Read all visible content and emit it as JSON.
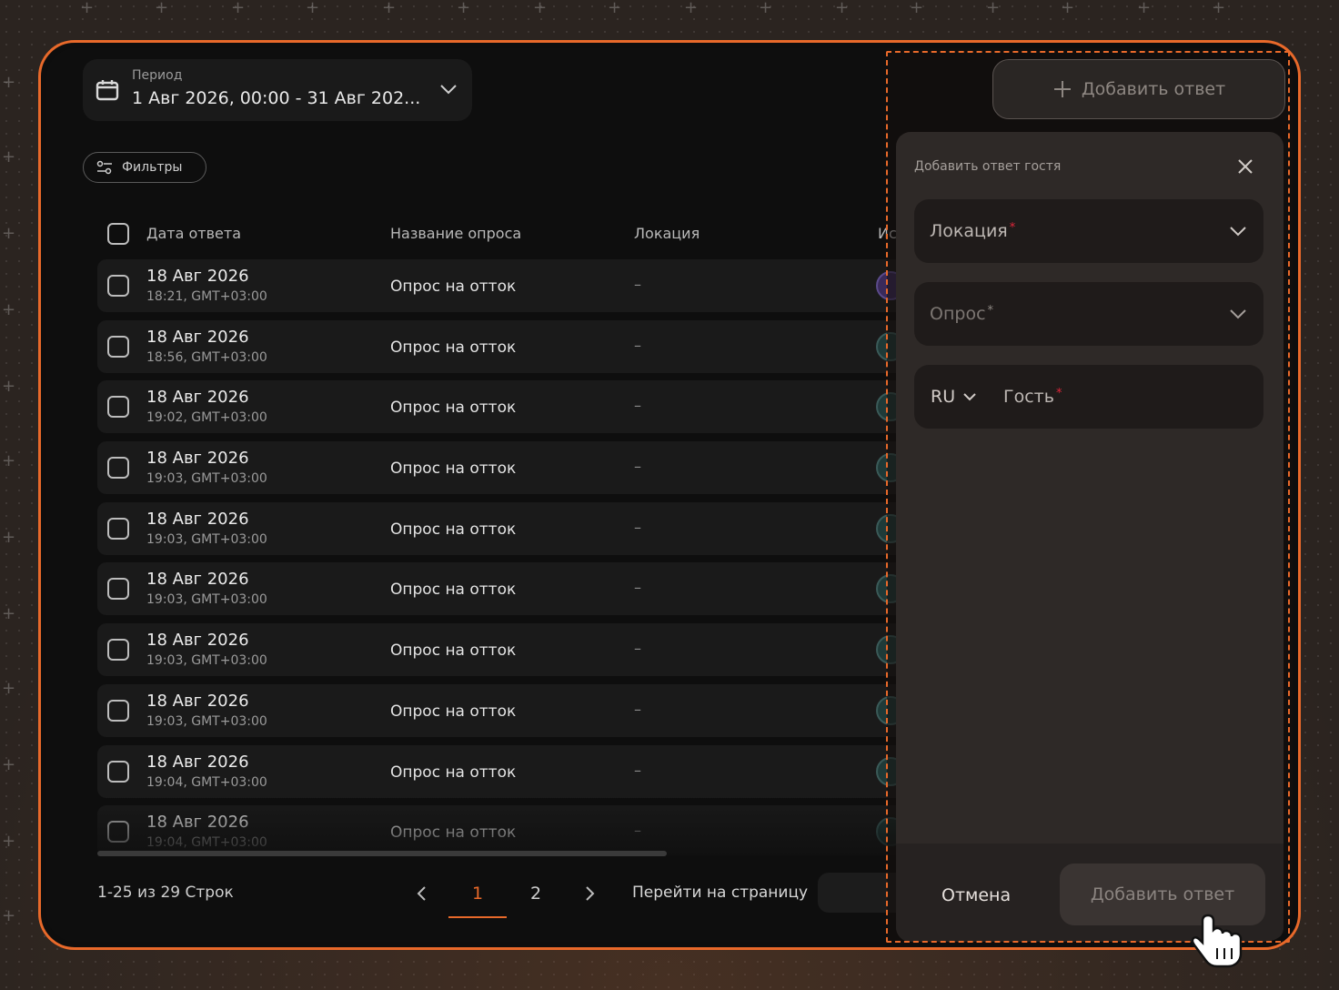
{
  "period": {
    "label": "Период",
    "value": "1 Авг 2026, 00:00 - 31 Авг 202..."
  },
  "filters": {
    "label": "Фильтры"
  },
  "table": {
    "headers": {
      "date": "Дата ответа",
      "survey": "Название опроса",
      "location": "Локация",
      "extra": "Ис"
    },
    "rows": [
      {
        "date": "18 Авг 2026",
        "time": "18:21, GMT+03:00",
        "survey": "Опрос на отток",
        "location": "–"
      },
      {
        "date": "18 Авг 2026",
        "time": "18:56, GMT+03:00",
        "survey": "Опрос на отток",
        "location": "–"
      },
      {
        "date": "18 Авг 2026",
        "time": "19:02, GMT+03:00",
        "survey": "Опрос на отток",
        "location": "–"
      },
      {
        "date": "18 Авг 2026",
        "time": "19:03, GMT+03:00",
        "survey": "Опрос на отток",
        "location": "–"
      },
      {
        "date": "18 Авг 2026",
        "time": "19:03, GMT+03:00",
        "survey": "Опрос на отток",
        "location": "–"
      },
      {
        "date": "18 Авг 2026",
        "time": "19:03, GMT+03:00",
        "survey": "Опрос на отток",
        "location": "–"
      },
      {
        "date": "18 Авг 2026",
        "time": "19:03, GMT+03:00",
        "survey": "Опрос на отток",
        "location": "–"
      },
      {
        "date": "18 Авг 2026",
        "time": "19:03, GMT+03:00",
        "survey": "Опрос на отток",
        "location": "–"
      },
      {
        "date": "18 Авг 2026",
        "time": "19:04, GMT+03:00",
        "survey": "Опрос на отток",
        "location": "–"
      },
      {
        "date": "18 Авг 2026",
        "time": "19:04, GMT+03:00",
        "survey": "Опрос на отток",
        "location": "–"
      }
    ]
  },
  "pagination": {
    "info": "1-25 из 29 Строк",
    "page1": "1",
    "page2": "2",
    "goto_label": "Перейти на страницу"
  },
  "add_button": {
    "label": "Добавить ответ"
  },
  "panel": {
    "title": "Добавить ответ гостя",
    "location_placeholder": "Локация",
    "survey_placeholder": "Опрос",
    "required_mark": "*",
    "lang": "RU",
    "guest_placeholder": "Гость",
    "cancel": "Отмена",
    "submit": "Добавить ответ"
  },
  "colors": {
    "accent": "#e8692a",
    "required": "#e0263a"
  }
}
